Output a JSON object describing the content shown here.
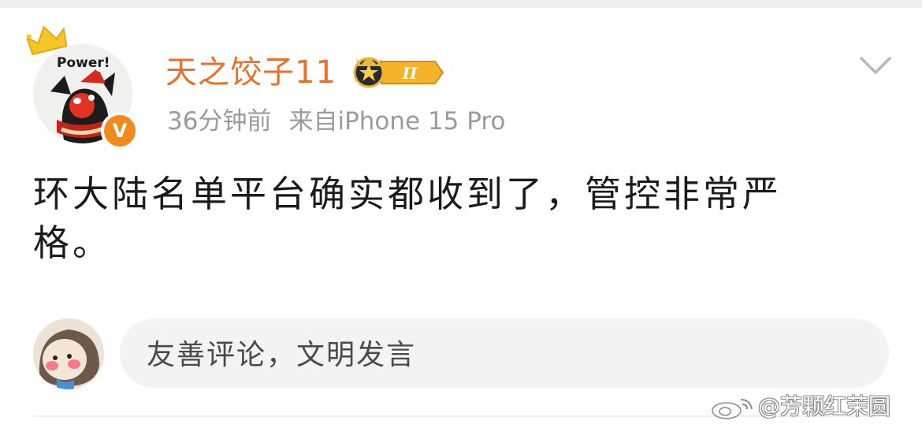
{
  "post": {
    "author": {
      "name": "天之饺子11",
      "level_badge": "II",
      "verified_mark": "V",
      "avatar_caption": "Power!"
    },
    "meta": {
      "time": "36分钟前",
      "source": "来自iPhone 15 Pro"
    },
    "text": "环大陆名单平台确实都收到了，管控非常严格。"
  },
  "comment_box": {
    "placeholder": "友善评论，文明发言"
  },
  "watermark": "@芳颗红茉圆",
  "colors": {
    "username": "#e8702a",
    "meta": "#9b9b9b",
    "verified": "#f08a1c",
    "input_bg": "#f3f3f3"
  },
  "icons": [
    "crown-icon",
    "verified-badge-icon",
    "level-badge-icon",
    "chevron-down-icon",
    "weibo-logo-icon"
  ]
}
